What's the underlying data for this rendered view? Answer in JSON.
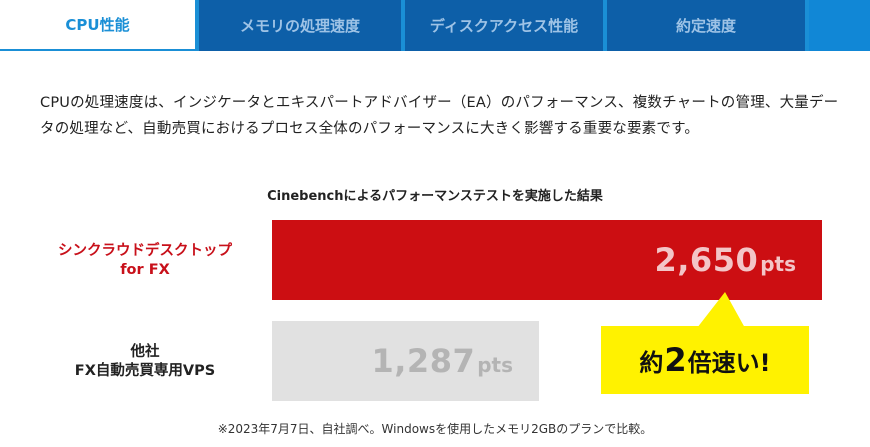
{
  "tabs": [
    {
      "label": "CPU性能",
      "active": true
    },
    {
      "label": "メモリの処理速度",
      "active": false
    },
    {
      "label": "ディスクアクセス性能",
      "active": false
    },
    {
      "label": "約定速度",
      "active": false
    }
  ],
  "description": "CPUの処理速度は、インジケータとエキスパートアドバイザー（EA）のパフォーマンス、複数チャートの管理、大量データの処理など、自動売買におけるプロセス全体のパフォーマンスに大きく影響する重要な要素です。",
  "colors": {
    "tab_bg": "#0d5fa8",
    "accent": "#1a8fd6",
    "primary_bar": "#cc0e12",
    "other_bar": "#e1e1e1",
    "callout": "#fff200"
  },
  "chart_data": {
    "type": "bar",
    "orientation": "horizontal",
    "title": "Cinebenchによるパフォーマンステストを実施した結果",
    "categories": [
      {
        "line1": "シンクラウドデスクトップ",
        "line2": "for FX"
      },
      {
        "line1": "他社",
        "line2": "FX自動売買専用VPS"
      }
    ],
    "values": [
      2650,
      1287
    ],
    "value_labels": [
      "2,650",
      "1,287"
    ],
    "unit": "pts",
    "xlim": [
      0,
      2650
    ],
    "callout": {
      "prefix": "約",
      "emphasis": "2",
      "suffix": "倍速い!"
    }
  },
  "footnote": "※2023年7月7日、自社調べ。Windowsを使用したメモリ2GBのプランで比較。"
}
